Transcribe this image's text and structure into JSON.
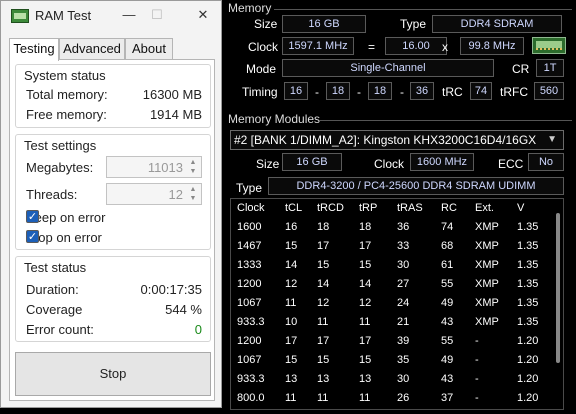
{
  "ramtest": {
    "title": "RAM Test",
    "controls": {
      "minimize": "—",
      "maximize": "☐",
      "close": "✕"
    },
    "tabs": [
      "Testing",
      "Advanced",
      "About"
    ],
    "system_status": {
      "title": "System status",
      "total_label": "Total memory:",
      "total_value": "16300 MB",
      "free_label": "Free memory:",
      "free_value": "1914 MB"
    },
    "test_settings": {
      "title": "Test settings",
      "megabytes_label": "Megabytes:",
      "megabytes_value": "11013",
      "threads_label": "Threads:",
      "threads_value": "12",
      "beep_label": "Beep on error",
      "stop_label": "Stop on error"
    },
    "test_status": {
      "title": "Test status",
      "duration_label": "Duration:",
      "duration_value": "0:00:17:35",
      "coverage_label": "Coverage",
      "coverage_value": "544 %",
      "errors_label": "Error count:",
      "errors_value": "0"
    },
    "stop_button": "Stop"
  },
  "memory": {
    "section": "Memory",
    "size_label": "Size",
    "size_value": "16 GB",
    "type_label": "Type",
    "type_value": "DDR4 SDRAM",
    "clock_label": "Clock",
    "clock_value": "1597.1 MHz",
    "eq": "=",
    "multiplier": "16.00",
    "x": "x",
    "bus": "99.8 MHz",
    "mode_label": "Mode",
    "mode_value": "Single-Channel",
    "cr_label": "CR",
    "cr_value": "1T",
    "timing_label": "Timing",
    "t1": "16",
    "t2": "18",
    "t3": "18",
    "t4": "36",
    "dash": "-",
    "trc_label": "tRC",
    "trc_value": "74",
    "trfc_label": "tRFC",
    "trfc_value": "560"
  },
  "modules": {
    "section": "Memory Modules",
    "selected": "#2 [BANK 1/DIMM_A2]: Kingston KHX3200C16D4/16GX",
    "size_label": "Size",
    "size_value": "16 GB",
    "clock_label": "Clock",
    "clock_value": "1600 MHz",
    "ecc_label": "ECC",
    "ecc_value": "No",
    "type_label": "Type",
    "type_value": "DDR4-3200 / PC4-25600 DDR4 SDRAM UDIMM",
    "columns": [
      "Clock",
      "tCL",
      "tRCD",
      "tRP",
      "tRAS",
      "RC",
      "Ext.",
      "V"
    ],
    "rows": [
      [
        "1600",
        "16",
        "18",
        "18",
        "36",
        "74",
        "XMP",
        "1.35"
      ],
      [
        "1467",
        "15",
        "17",
        "17",
        "33",
        "68",
        "XMP",
        "1.35"
      ],
      [
        "1333",
        "14",
        "15",
        "15",
        "30",
        "61",
        "XMP",
        "1.35"
      ],
      [
        "1200",
        "12",
        "14",
        "14",
        "27",
        "55",
        "XMP",
        "1.35"
      ],
      [
        "1067",
        "11",
        "12",
        "12",
        "24",
        "49",
        "XMP",
        "1.35"
      ],
      [
        "933.3",
        "10",
        "11",
        "11",
        "21",
        "43",
        "XMP",
        "1.35"
      ],
      [
        "1200",
        "17",
        "17",
        "17",
        "39",
        "55",
        "-",
        "1.20"
      ],
      [
        "1067",
        "15",
        "15",
        "15",
        "35",
        "49",
        "-",
        "1.20"
      ],
      [
        "933.3",
        "13",
        "13",
        "13",
        "30",
        "43",
        "-",
        "1.20"
      ],
      [
        "800.0",
        "11",
        "11",
        "11",
        "26",
        "37",
        "-",
        "1.20"
      ]
    ]
  }
}
